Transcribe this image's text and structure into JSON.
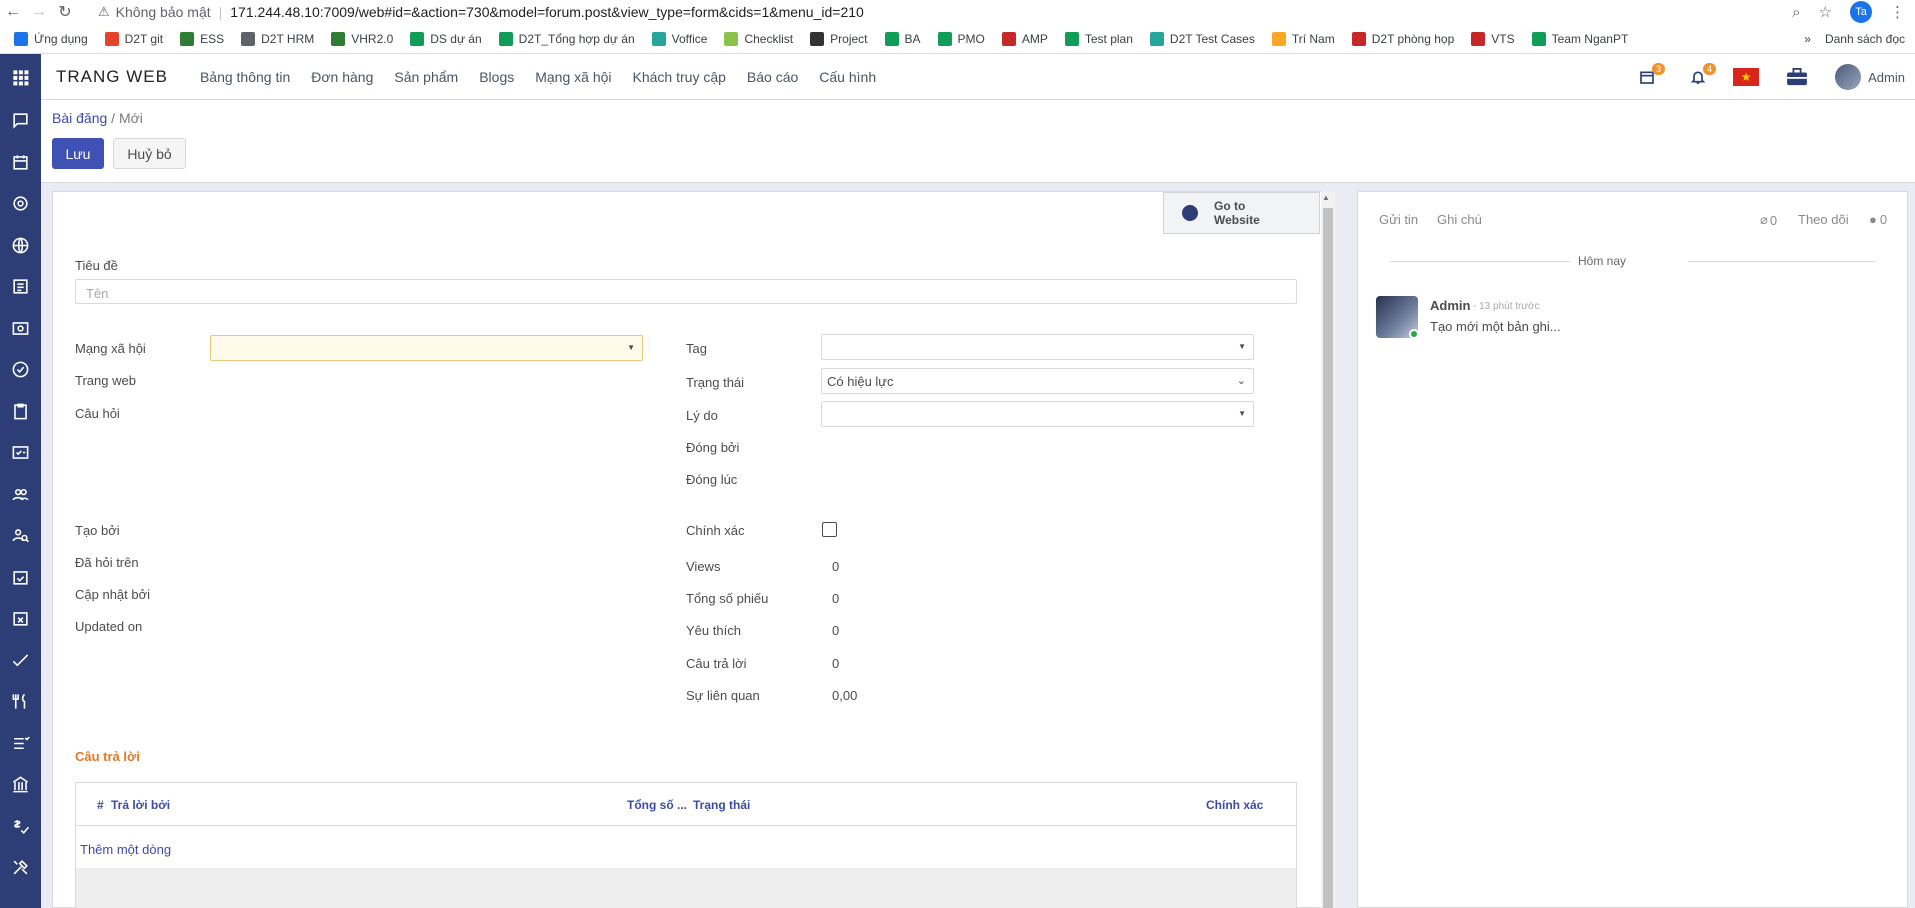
{
  "browser": {
    "security_text": "Không bảo mật",
    "url": "171.244.48.10:7009/web#id=&action=730&model=forum.post&view_type=form&cids=1&menu_id=210",
    "profile_initials": "Ta",
    "bookmarks": [
      {
        "label": "Ứng dụng",
        "icon": "apps-grid-icon",
        "color": "#1a73e8"
      },
      {
        "label": "D2T git",
        "icon": "gitlab-icon",
        "color": "#e24329"
      },
      {
        "label": "ESS",
        "icon": "shield-icon",
        "color": "#2e7d32"
      },
      {
        "label": "D2T HRM",
        "icon": "globe-icon",
        "color": "#5f6368"
      },
      {
        "label": "VHR2.0",
        "icon": "shield-icon",
        "color": "#2e7d32"
      },
      {
        "label": "DS dự án",
        "icon": "sheets-icon",
        "color": "#0f9d58"
      },
      {
        "label": "D2T_Tổng hợp dự án",
        "icon": "sheets-icon",
        "color": "#0f9d58"
      },
      {
        "label": "Voffice",
        "icon": "voffice-icon",
        "color": "#26a69a"
      },
      {
        "label": "Checklist",
        "icon": "checklist-icon",
        "color": "#8bc34a"
      },
      {
        "label": "Project",
        "icon": "project-icon",
        "color": "#333333"
      },
      {
        "label": "BA",
        "icon": "sheets-icon",
        "color": "#0f9d58"
      },
      {
        "label": "PMO",
        "icon": "sheets-icon",
        "color": "#0f9d58"
      },
      {
        "label": "AMP",
        "icon": "amp-icon",
        "color": "#c62828"
      },
      {
        "label": "Test plan",
        "icon": "sheets-icon",
        "color": "#0f9d58"
      },
      {
        "label": "D2T Test Cases",
        "icon": "testcase-icon",
        "color": "#26a69a"
      },
      {
        "label": "Trí Nam",
        "icon": "trinam-icon",
        "color": "#f9a825"
      },
      {
        "label": "D2T phòng họp",
        "icon": "amp-icon",
        "color": "#c62828"
      },
      {
        "label": "VTS",
        "icon": "amp-icon",
        "color": "#c62828"
      },
      {
        "label": "Team NganPT",
        "icon": "sheets-icon",
        "color": "#0f9d58"
      }
    ],
    "bookmarks_more": "»",
    "reading_list": "Danh sách đọc"
  },
  "topnav": {
    "brand": "TRANG WEB",
    "menu": [
      "Bảng thông tin",
      "Đơn hàng",
      "Sản phẩm",
      "Blogs",
      "Mạng xã hội",
      "Khách truy cập",
      "Báo cáo",
      "Cấu hình"
    ],
    "activity_count": "3",
    "notification_count": "4",
    "user": "Admin"
  },
  "control": {
    "breadcrumb_parent": "Bài đăng",
    "breadcrumb_sep": "/",
    "breadcrumb_current": "Mới",
    "save": "Lưu",
    "cancel": "Huỷ bỏ"
  },
  "form": {
    "go_website": [
      "Go to",
      "Website"
    ],
    "title_label": "Tiêu đề",
    "title_placeholder": "Tên",
    "left": {
      "social": "Mạng xã hội",
      "website": "Trang web",
      "question": "Câu hỏi",
      "created_by": "Tạo bởi",
      "asked_on": "Đã hỏi trên",
      "updated_by": "Cập nhật bởi",
      "updated_on": "Updated on"
    },
    "right": {
      "tag": "Tag",
      "state": "Trạng thái",
      "state_value": "Có hiệu lực",
      "reason": "Lý do",
      "closed_by": "Đóng bởi",
      "closed_on": "Đóng lúc",
      "accurate": "Chính xác",
      "views": "Views",
      "views_value": "0",
      "votes": "Tổng số phiếu",
      "votes_value": "0",
      "favorites": "Yêu thích",
      "favorites_value": "0",
      "answers": "Câu trả lời",
      "answers_value": "0",
      "relevance": "Sự liên quan",
      "relevance_value": "0,00"
    },
    "answers_section": "Câu trả lời",
    "table_headers": {
      "hash": "#",
      "answered_by": "Trả lời bởi",
      "total": "Tổng số ...",
      "state": "Trạng thái",
      "accurate": "Chính xác"
    },
    "add_line": "Thêm một dòng"
  },
  "chatter": {
    "send_message": "Gửi tin",
    "log_note": "Ghi chú",
    "attachments": "0",
    "follow": "Theo dõi",
    "followers": "0",
    "today": "Hôm nay",
    "message": {
      "author": "Admin",
      "time": "- 13 phút trước",
      "body": "Tạo mới một bản ghi..."
    }
  }
}
